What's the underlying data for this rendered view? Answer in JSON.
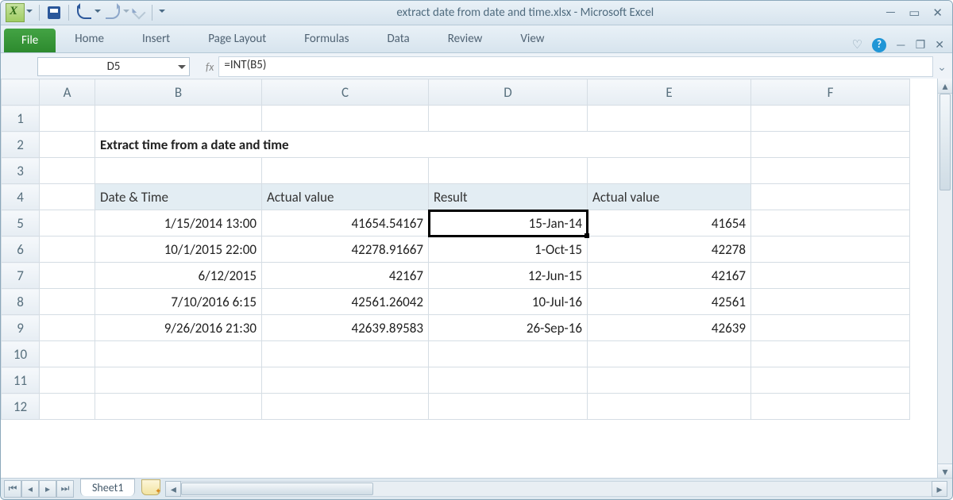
{
  "titlebar": {
    "doc_title": "extract date from date and time.xlsx  -  Microsoft Excel"
  },
  "ribbon": {
    "file": "File",
    "tabs": [
      "Home",
      "Insert",
      "Page Layout",
      "Formulas",
      "Data",
      "Review",
      "View"
    ]
  },
  "formula_bar": {
    "name_box": "D5",
    "fx_label": "fx",
    "formula": "=INT(B5)"
  },
  "columns": [
    "A",
    "B",
    "C",
    "D",
    "E",
    "F"
  ],
  "rows": [
    "1",
    "2",
    "3",
    "4",
    "5",
    "6",
    "7",
    "8",
    "9",
    "10",
    "11",
    "12"
  ],
  "active": {
    "col": "D",
    "row": "5"
  },
  "sheet_title": "Extract time from a date and time",
  "table": {
    "headers": [
      "Date & Time",
      "Actual value",
      "Result",
      "Actual value"
    ],
    "rows": [
      {
        "date_time": "1/15/2014 13:00",
        "actual1": "41654.54167",
        "result": "15-Jan-14",
        "actual2": "41654"
      },
      {
        "date_time": "10/1/2015 22:00",
        "actual1": "42278.91667",
        "result": "1-Oct-15",
        "actual2": "42278"
      },
      {
        "date_time": "6/12/2015",
        "actual1": "42167",
        "result": "12-Jun-15",
        "actual2": "42167"
      },
      {
        "date_time": "7/10/2016 6:15",
        "actual1": "42561.26042",
        "result": "10-Jul-16",
        "actual2": "42561"
      },
      {
        "date_time": "9/26/2016 21:30",
        "actual1": "42639.89583",
        "result": "26-Sep-16",
        "actual2": "42639"
      }
    ]
  },
  "sheet_tab": "Sheet1"
}
